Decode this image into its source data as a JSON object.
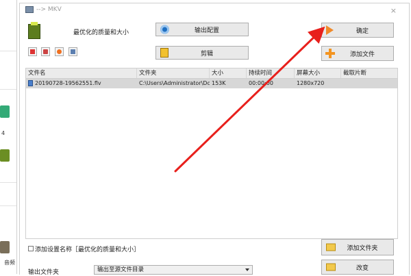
{
  "window": {
    "title": "--> MKV"
  },
  "background": {
    "text_4": "4",
    "text_audio": "音频"
  },
  "profile": {
    "label": "最优化的质量和大小"
  },
  "buttons": {
    "output_settings": "输出配置",
    "edit": "剪辑",
    "ok": "确定",
    "add_file": "添加文件",
    "add_folder": "添加文件夹",
    "change": "改变"
  },
  "table": {
    "columns": [
      "文件名",
      "文件夹",
      "大小",
      "持续时间",
      "屏幕大小",
      "截取片断"
    ],
    "rows": [
      {
        "name": "20190728-19562551.flv",
        "folder": "C:\\Users\\Administrator\\Doc...",
        "size": "153K",
        "duration": "00:00:00",
        "screen": "1280x720",
        "clip": ""
      }
    ]
  },
  "options": {
    "add_setting_name": "添加设置名称［最优化的质量和大小］"
  },
  "output": {
    "label": "输出文件夹",
    "selected": "输出至源文件目录"
  },
  "annotation": {
    "color": "#e8201c"
  }
}
